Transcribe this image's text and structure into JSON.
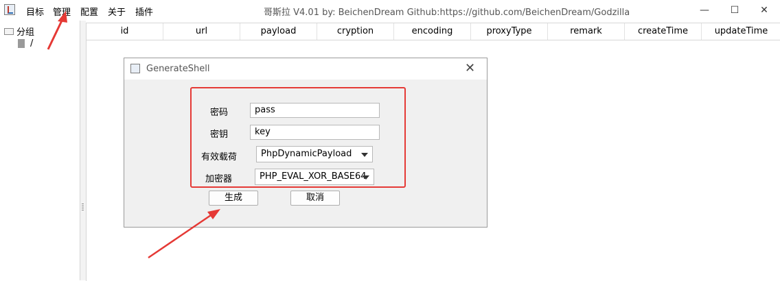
{
  "menu": {
    "items": [
      "目标",
      "管理",
      "配置",
      "关于",
      "插件"
    ]
  },
  "window": {
    "title": "哥斯拉    V4.01 by: BeichenDream Github:https://github.com/BeichenDream/Godzilla",
    "minimize_glyph": "—",
    "maximize_glyph": "☐",
    "close_glyph": "✕"
  },
  "tree": {
    "group_label": "分组",
    "child_label": "/"
  },
  "table": {
    "columns": [
      "id",
      "url",
      "payload",
      "cryption",
      "encoding",
      "proxyType",
      "remark",
      "createTime",
      "updateTime"
    ]
  },
  "dialog": {
    "title": "GenerateShell",
    "close_glyph": "✕",
    "password_label": "密码",
    "password_value": "pass",
    "key_label": "密钥",
    "key_value": "key",
    "payload_label": "有效载荷",
    "payload_value": "PhpDynamicPayload",
    "cryption_label": "加密器",
    "cryption_value": "PHP_EVAL_XOR_BASE64",
    "generate_label": "生成",
    "cancel_label": "取消"
  },
  "colors": {
    "annotation_red": "#e53935"
  }
}
